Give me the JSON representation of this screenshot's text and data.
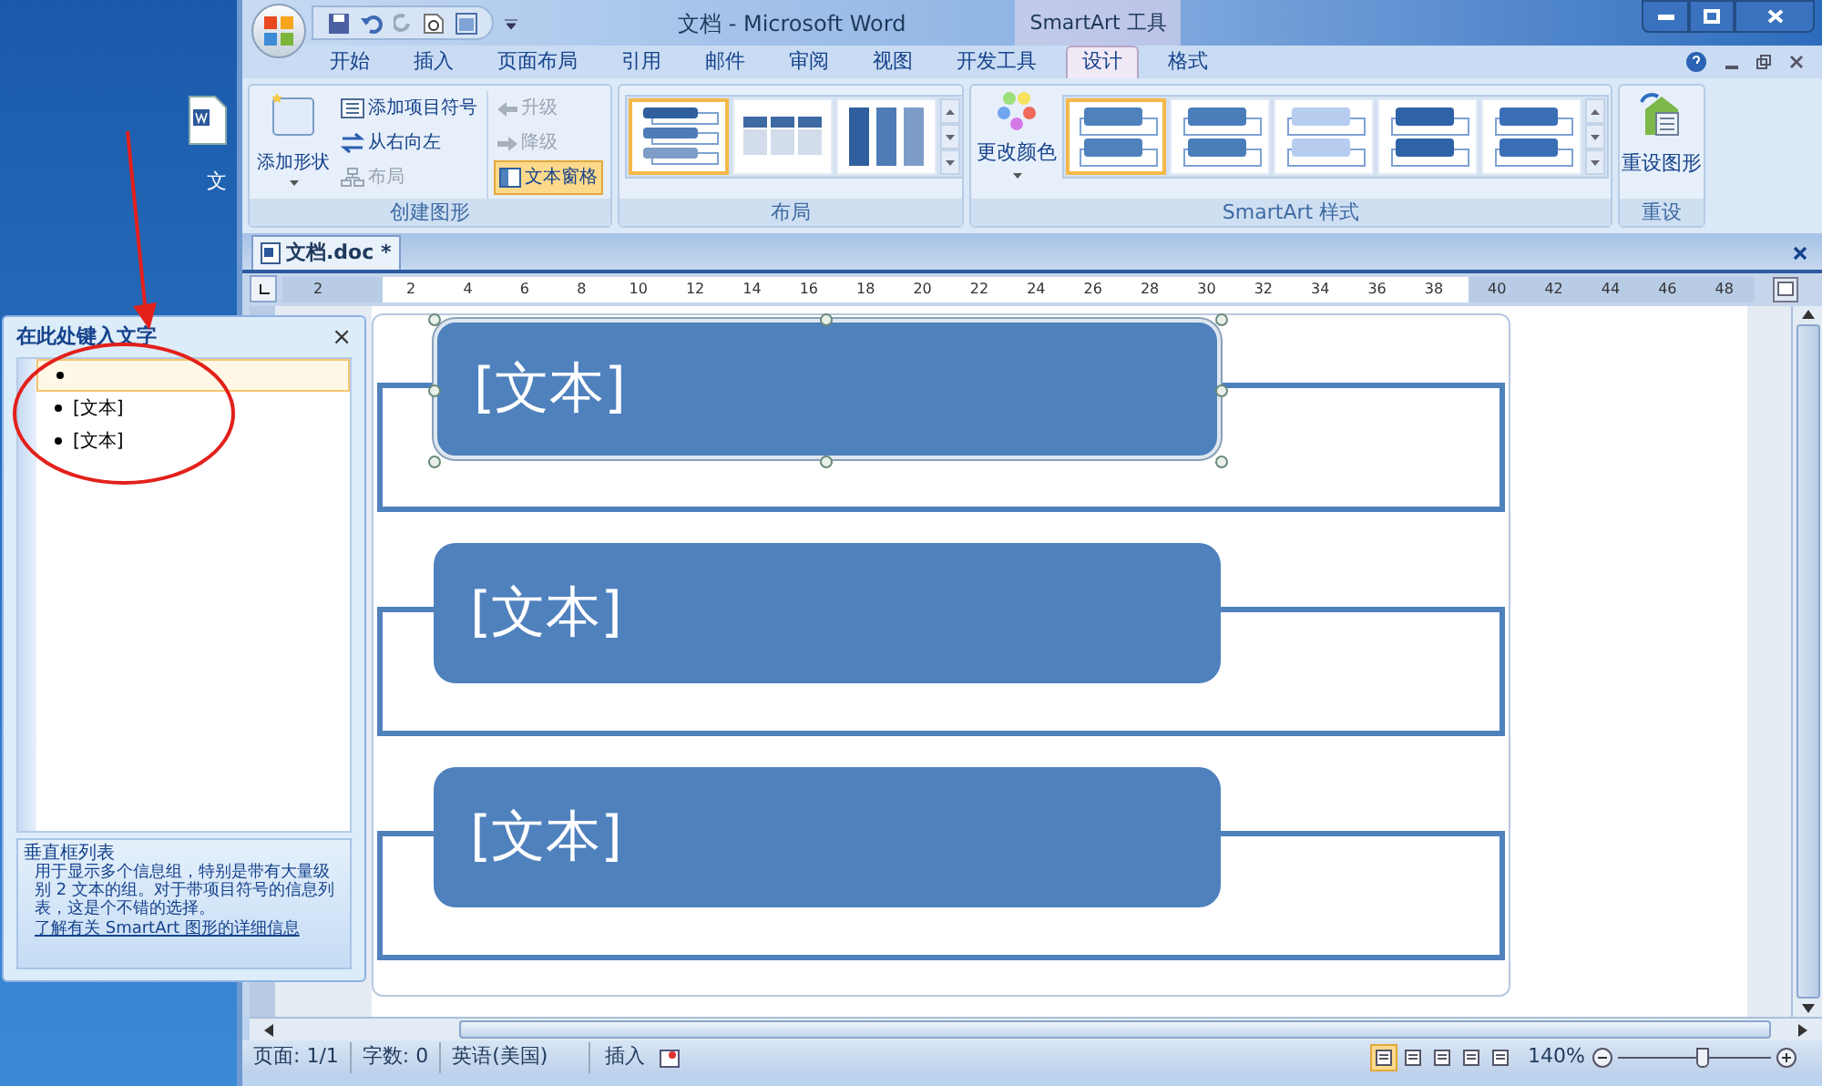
{
  "desktop_icon": {
    "label": "文"
  },
  "window": {
    "title": "文档 - Microsoft Word",
    "context_tab": "SmartArt 工具"
  },
  "tabs": [
    {
      "label": "开始",
      "selected": false
    },
    {
      "label": "插入",
      "selected": false
    },
    {
      "label": "页面布局",
      "selected": false
    },
    {
      "label": "引用",
      "selected": false
    },
    {
      "label": "邮件",
      "selected": false
    },
    {
      "label": "审阅",
      "selected": false
    },
    {
      "label": "视图",
      "selected": false
    },
    {
      "label": "开发工具",
      "selected": false
    },
    {
      "label": "设计",
      "selected": true
    },
    {
      "label": "格式",
      "selected": false
    }
  ],
  "ribbon": {
    "create_group": {
      "title": "创建图形",
      "add_shape": "添加形状",
      "column_1": [
        {
          "label": "添加项目符号",
          "disabled": false,
          "pressed": false
        },
        {
          "label": "从右向左",
          "disabled": false,
          "pressed": false
        },
        {
          "label": "布局",
          "disabled": true,
          "pressed": false
        }
      ],
      "column_2": [
        {
          "label": "升级",
          "disabled": true,
          "pressed": false
        },
        {
          "label": "降级",
          "disabled": true,
          "pressed": false
        },
        {
          "label": "文本窗格",
          "disabled": false,
          "pressed": true
        }
      ]
    },
    "layout_group": {
      "title": "布局",
      "layouts": [
        {
          "selected": true
        },
        {
          "selected": false
        },
        {
          "selected": false
        }
      ]
    },
    "styles_group": {
      "title": "SmartArt 样式",
      "change_colors": "更改颜色",
      "styles": [
        {
          "selected": true
        },
        {
          "selected": false
        },
        {
          "selected": false
        },
        {
          "selected": false
        },
        {
          "selected": false
        }
      ]
    },
    "reset_group": {
      "title": "重设",
      "reset_graphic": "重设图形"
    }
  },
  "document_tab": {
    "label": "文档.doc *"
  },
  "ruler_marks": [
    "2",
    "2",
    "4",
    "6",
    "8",
    "10",
    "12",
    "14",
    "16",
    "18",
    "20",
    "22",
    "24",
    "26",
    "28",
    "30",
    "32",
    "34",
    "36",
    "38",
    "40",
    "42",
    "44",
    "46",
    "48"
  ],
  "smartart_shapes": [
    {
      "text": "[文本]",
      "selected": true
    },
    {
      "text": "[文本]",
      "selected": false
    },
    {
      "text": "[文本]",
      "selected": false
    }
  ],
  "text_pane": {
    "title": "在此处键入文字",
    "close": "×",
    "items": [
      {
        "selected": true
      },
      {
        "text": "[文本]",
        "selected": false
      },
      {
        "text": "[文本]",
        "selected": false
      }
    ],
    "description_title": "垂直框列表",
    "description": "用于显示多个信息组，特别是带有大量级别 2 文本的组。对于带项目符号的信息列表，这是个不错的选择。",
    "link": "了解有关 SmartArt 图形的详细信息"
  },
  "status_bar": {
    "page": "页面: 1/1",
    "words": "字数: 0",
    "language": "英语(美国)",
    "mode": "插入",
    "views": [
      {
        "selected": true
      },
      {
        "selected": false
      },
      {
        "selected": false
      },
      {
        "selected": false
      },
      {
        "selected": false
      }
    ],
    "zoom": "140%",
    "zoom_slider": {
      "level": 0.55
    }
  }
}
